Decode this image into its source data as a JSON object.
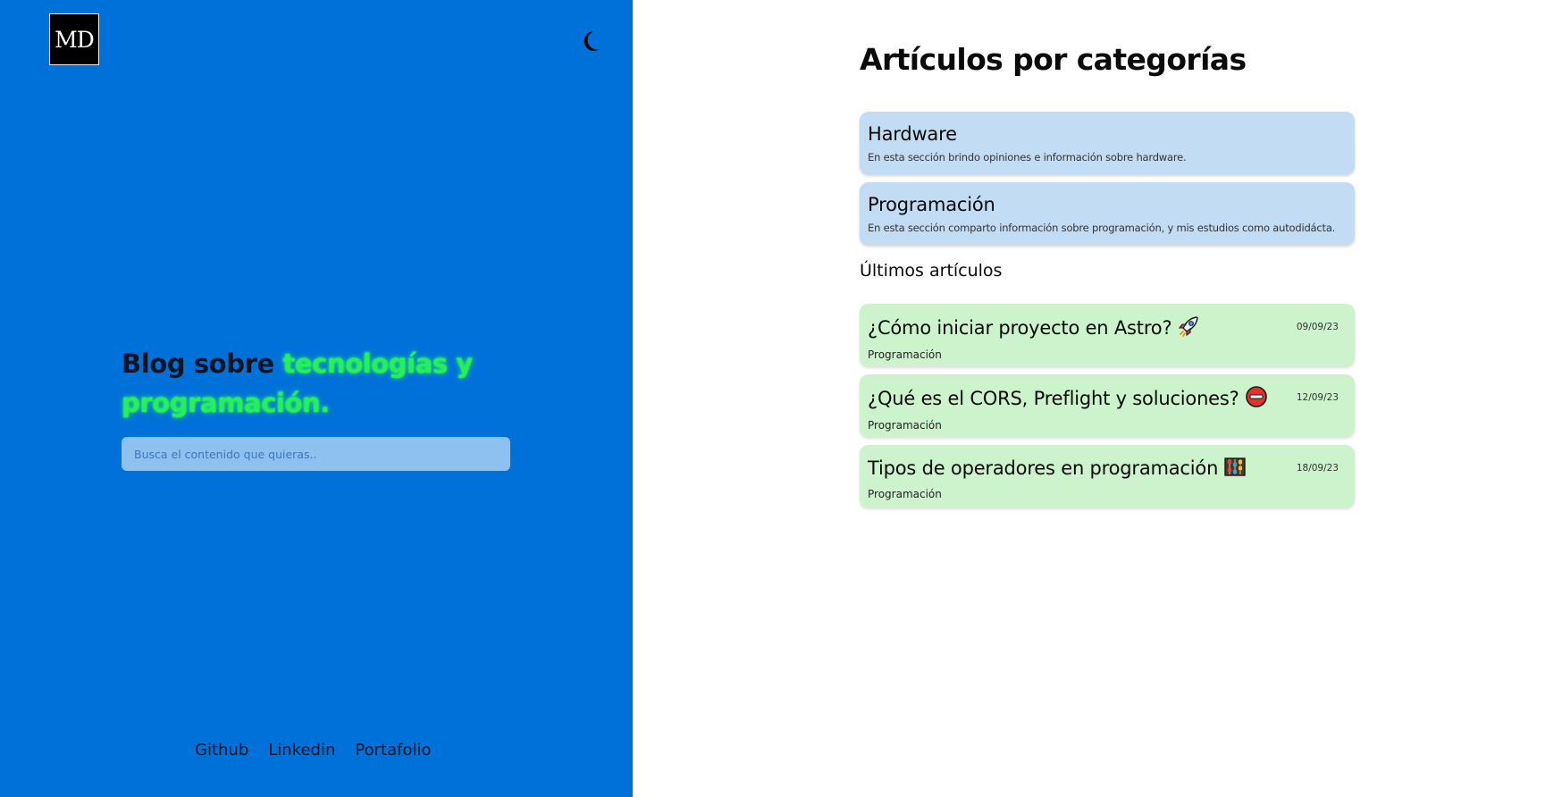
{
  "sidebar": {
    "logo_text": "MD",
    "theme_toggle_icon": "moon-icon",
    "hero": {
      "text_plain": "Blog sobre ",
      "text_highlight": "tecnologías y programación."
    },
    "search": {
      "placeholder": "Busca el contenido que quieras..",
      "value": ""
    },
    "footer_links": [
      "Github",
      "Linkedin",
      "Portafolio"
    ]
  },
  "main": {
    "title": "Artículos por categorías",
    "categories": [
      {
        "title": "Hardware",
        "description": "En esta sección brindo opiniones e información sobre hardware."
      },
      {
        "title": "Programación",
        "description": "En esta sección comparto información sobre programación, y mis estudios como autodidácta."
      }
    ],
    "latest_title": "Últimos artículos",
    "articles": [
      {
        "title": "¿Cómo iniciar proyecto en Astro?",
        "icon": "rocket-icon",
        "date": "09/09/23",
        "category": "Programación"
      },
      {
        "title": "¿Qué es el CORS, Preflight y soluciones?",
        "icon": "no-entry-icon",
        "date": "12/09/23",
        "category": "Programación"
      },
      {
        "title": "Tipos de operadores en programación",
        "icon": "abacus-icon",
        "date": "18/09/23",
        "category": "Programación"
      }
    ]
  },
  "colors": {
    "sidebar_bg": "#0071d9",
    "highlight": "#25f05a",
    "category_card_bg": "#c2dcf4",
    "article_card_bg": "#ccf3cc"
  }
}
